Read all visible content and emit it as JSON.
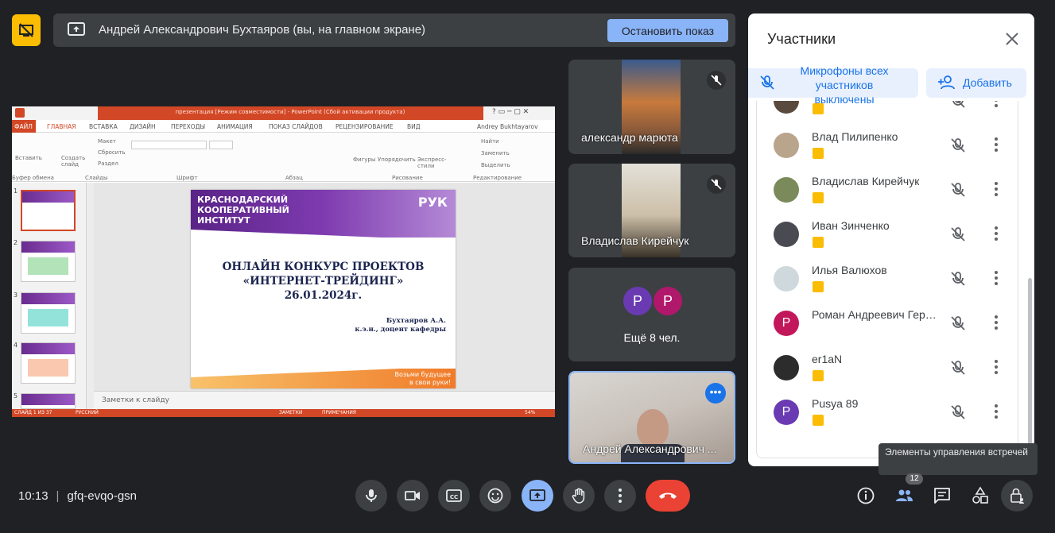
{
  "presenting": {
    "text": "Андрей Александрович Бухтаяров (вы, на главном экране)",
    "stop_label": "Остановить показ"
  },
  "powerpoint": {
    "title": "презентация [Режим совместимости] - PowerPoint (Сбой активации продукта)",
    "tabs": [
      "ФАЙЛ",
      "ГЛАВНАЯ",
      "ВСТАВКА",
      "ДИЗАЙН",
      "ПЕРЕХОДЫ",
      "АНИМАЦИЯ",
      "ПОКАЗ СЛАЙДОВ",
      "РЕЦЕНЗИРОВАНИЕ",
      "ВИД"
    ],
    "user": "Andrey Bukhtayarov",
    "ribbon": {
      "paste": "Вставить",
      "create_slide": "Создать слайд",
      "layout": "Макет",
      "reset": "Сбросить",
      "section": "Раздел",
      "clipboard": "Буфер обмена",
      "slides": "Слайды",
      "font": "Шрифт",
      "paragraph": "Абзац",
      "shapes": "Фигуры",
      "arrange": "Упорядочить",
      "quick_styles": "Экспресс-стили",
      "drawing": "Рисование",
      "find": "Найти",
      "replace": "Заменить",
      "select": "Выделить",
      "editing": "Редактирование"
    },
    "thumb_numbers": [
      "1",
      "2",
      "3",
      "4",
      "5"
    ],
    "slide": {
      "institute": "КРАСНОДАРСКИЙ\nКООПЕРАТИВНЫЙ\nИНСТИТУТ",
      "logo": "РУК",
      "title": "ОНЛАЙН КОНКУРС ПРОЕКТОВ\n«ИНТЕРНЕТ-ТРЕЙДИНГ»\n26.01.2024г.",
      "author": "Бухтаяров А.А.\nк.э.н., доцент кафедры",
      "motto": "Возьми будущее\nв свои руки!"
    },
    "notes_placeholder": "Заметки к слайду",
    "status": {
      "slide": "СЛАЙД 1 ИЗ 37",
      "language": "РУССКИЙ",
      "notes": "ЗАМЕТКИ",
      "comments": "ПРИМЕЧАНИЯ",
      "zoom": "54%"
    }
  },
  "tiles": [
    {
      "name": "александр марюта"
    },
    {
      "name": "Владислав Кирейчук"
    },
    {
      "avatars": [
        "P",
        "P"
      ],
      "label": "Ещё 8 чел."
    },
    {
      "name": "Андрей Александрович ..."
    }
  ],
  "panel": {
    "title": "Участники",
    "mute_all": "Микрофоны всех участников выключены",
    "add": "Добавить",
    "participants": [
      {
        "name": "Влад Пилипенко"
      },
      {
        "name": "Владислав Кирейчук"
      },
      {
        "name": "Иван Зинченко"
      },
      {
        "name": "Илья Валюхов"
      },
      {
        "name": "Роман Андреевич Гера...",
        "initial": "P"
      },
      {
        "name": "er1aN"
      },
      {
        "name": "Pusya 89",
        "initial": "P"
      }
    ]
  },
  "tooltip": "Элементы управления встречей",
  "meeting": {
    "time": "10:13",
    "code": "gfq-evqo-gsn",
    "people_count": "12"
  },
  "colors": {
    "accent": "#8ab4f8",
    "hangup": "#ea4335",
    "present_flag": "#fbbc04",
    "ppt_red": "#d24726"
  }
}
